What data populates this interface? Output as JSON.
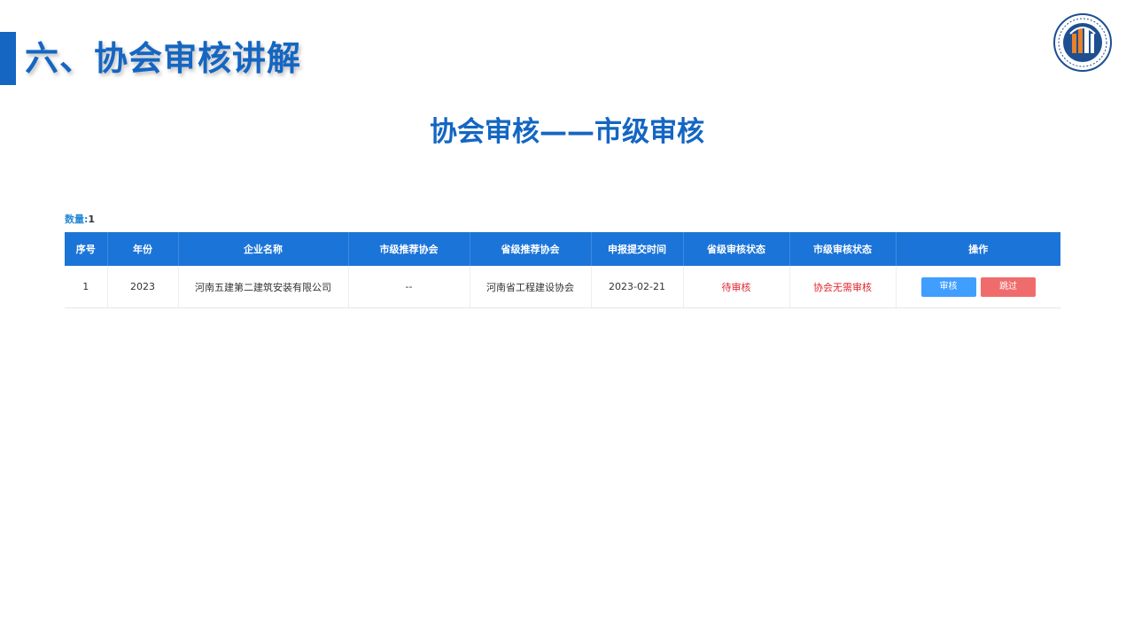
{
  "section": {
    "title": "六、协会审核讲解"
  },
  "slide": {
    "subtitle": "协会审核——市级审核"
  },
  "logo": {
    "icon": "association-emblem-icon",
    "colors": {
      "ring": "#1d4f91",
      "building": "#e8812a"
    }
  },
  "summary": {
    "count_label": "数量:",
    "count_value": "1"
  },
  "table": {
    "headers": [
      "序号",
      "年份",
      "企业名称",
      "市级推荐协会",
      "省级推荐协会",
      "申报提交时间",
      "省级审核状态",
      "市级审核状态",
      "操作"
    ],
    "rows": [
      {
        "index": "1",
        "year": "2023",
        "company": "河南五建第二建筑安装有限公司",
        "city_assoc": "--",
        "province_assoc": "河南省工程建设协会",
        "submit_time": "2023-02-21",
        "province_status": "待审核",
        "city_status": "协会无需审核",
        "actions": {
          "review": "审核",
          "skip": "跳过"
        }
      }
    ]
  },
  "colors": {
    "brand_blue": "#1466c2",
    "header_blue": "#1b74d8",
    "status_red": "#e0262d",
    "review_button": "#409eff",
    "skip_button": "#f06c6c"
  }
}
